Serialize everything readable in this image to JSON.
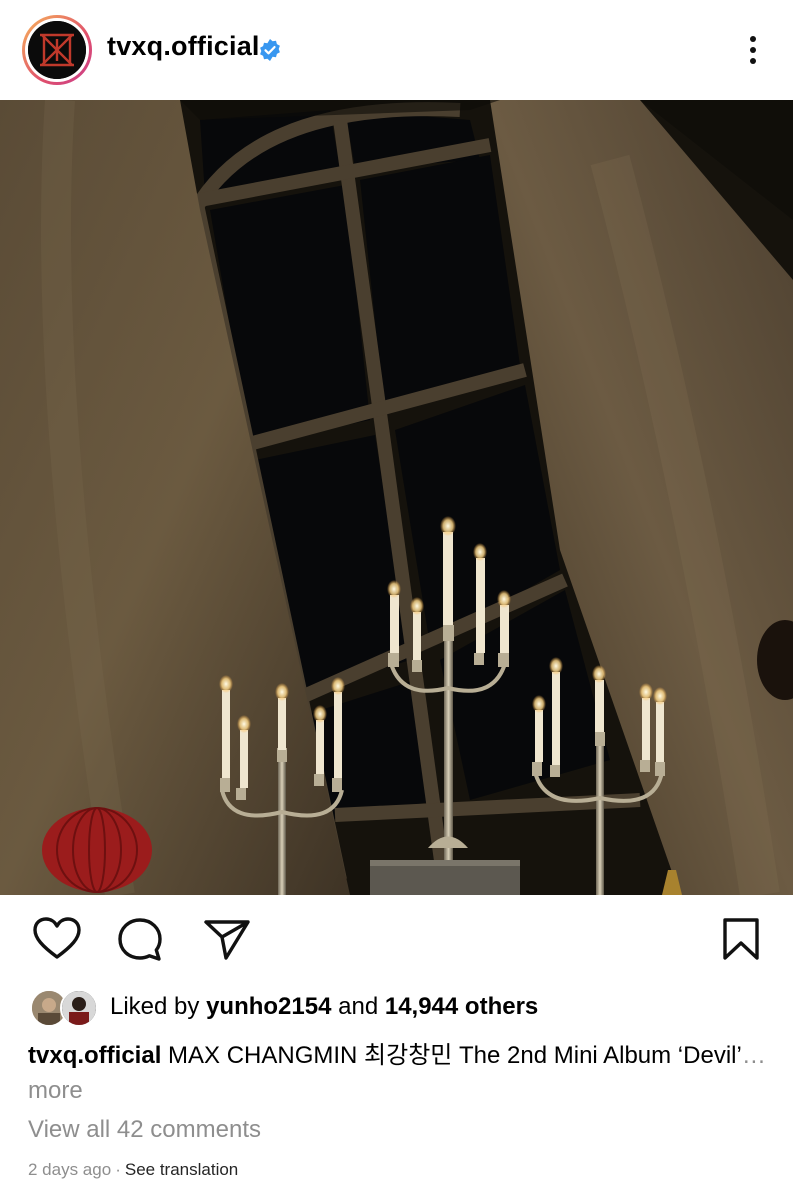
{
  "header": {
    "username": "tvxq.official",
    "avatar_icon": "tvxq-logo-icon",
    "verified_icon": "verified-badge-icon",
    "more_icon": "more-options-icon",
    "verified_color": "#3897f0"
  },
  "post": {
    "image_description_icon": "post-photo"
  },
  "actions": {
    "like_icon": "heart-icon",
    "comment_icon": "comment-icon",
    "share_icon": "send-icon",
    "save_icon": "bookmark-icon"
  },
  "likes": {
    "prefix": "Liked by",
    "user": "yunho2154",
    "connector": "and",
    "others": "14,944 others"
  },
  "caption": {
    "user": "tvxq.official",
    "text": "MAX CHANGMIN 최강창민 The 2nd Mini Album ‘Devil’",
    "ellipsis": "…",
    "more": "more"
  },
  "comments": {
    "label": "View all 42 comments"
  },
  "meta": {
    "time": "2 days ago",
    "separator": "·",
    "translate": "See translation"
  }
}
